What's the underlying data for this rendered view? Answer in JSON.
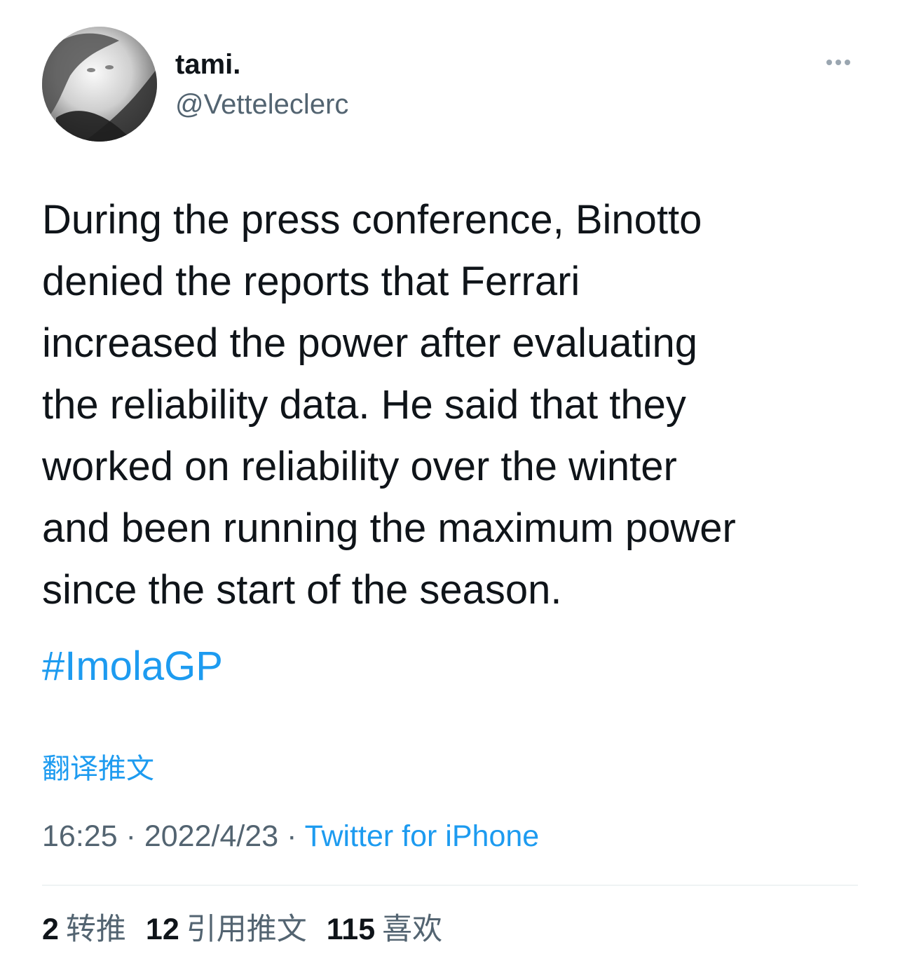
{
  "author": {
    "display_name": "tami.",
    "handle": "@Vetteleclerc"
  },
  "tweet": {
    "text": "During the press conference, Binotto\ndenied the reports that Ferrari\nincreased the power after evaluating\nthe reliability data. He said that they\nworked on reliability over the winter\nand been running the maximum power\nsince the start of the season.",
    "hashtag": "#ImolaGP",
    "translate_label": "翻译推文"
  },
  "meta": {
    "time": "16:25",
    "separator": "·",
    "date": "2022/4/23",
    "source": "Twitter for iPhone"
  },
  "stats": [
    {
      "count": "2",
      "label": "转推"
    },
    {
      "count": "12",
      "label": "引用推文"
    },
    {
      "count": "115",
      "label": "喜欢"
    }
  ],
  "colors": {
    "accent": "#1d9bf0",
    "text": "#0f1419",
    "secondary": "#536471",
    "divider": "#eff3f4"
  },
  "icons": {
    "more": "more-horizontal-icon"
  }
}
